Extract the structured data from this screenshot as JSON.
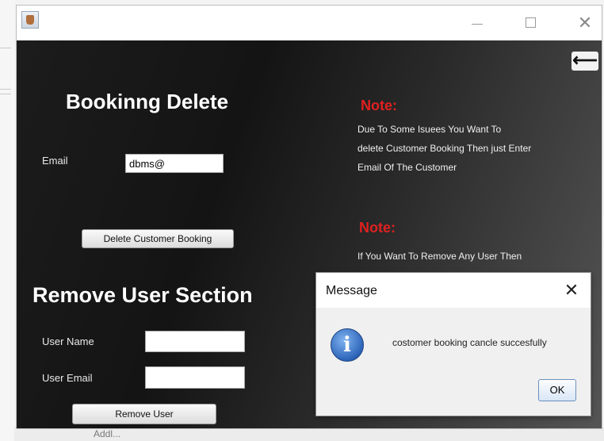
{
  "background": {
    "bottom_text": "Addl..."
  },
  "window": {
    "icon": "java-cup-icon",
    "minimize_glyph": "—",
    "maximize_glyph": "☐",
    "close_glyph": "✕",
    "back_glyph": "⟵"
  },
  "booking": {
    "title": "Bookinng Delete",
    "email_label": "Email",
    "email_value": "dbms@",
    "delete_button": "Delete Customer Booking"
  },
  "remove_user": {
    "title": "Remove User Section",
    "username_label": "User Name",
    "username_value": "",
    "email_label": "User Email",
    "email_value": "",
    "remove_button": "Remove User"
  },
  "notes": [
    {
      "heading": "Note:",
      "text_lines": [
        "Due To Some Isuees You Want To",
        "delete Customer Booking Then just Enter",
        "Email Of The Customer"
      ]
    },
    {
      "heading": "Note:",
      "text_lines": [
        "If You Want To Remove Any  User Then"
      ]
    }
  ],
  "dialog": {
    "title": "Message",
    "close_glyph": "✕",
    "icon": "information-icon",
    "icon_glyph": "i",
    "message": "costomer booking cancle succesfully",
    "ok_button": "OK"
  },
  "colors": {
    "note_heading": "#e02020",
    "panel_dark": "#141414"
  }
}
